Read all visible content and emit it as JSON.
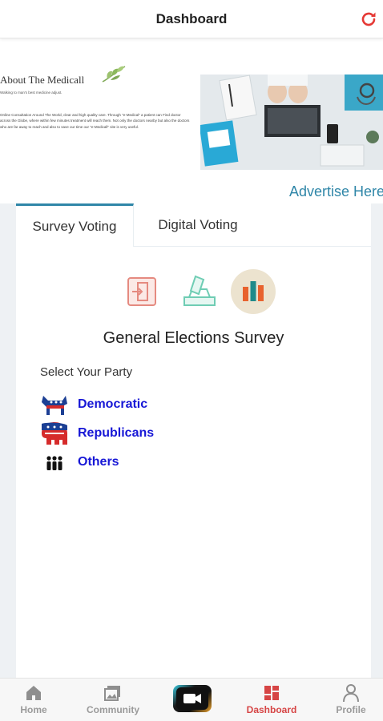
{
  "header": {
    "title": "Dashboard",
    "refresh_icon": "refresh-icon",
    "accent_color": "#e53935"
  },
  "banner": {
    "title": "About The Medicall",
    "subtitle": "Walking to man's best medicine adjust.",
    "body": "Online Consultation Around The World, clear and high quality care. Through \"e-Medical\" a patient can Find doctor across the Globe, where within few minutes treatment will reach them. Not only the doctors nearby but also the doctors who are far away to reach and also to save our time our \"e-Medicall\" site is very useful.",
    "advertise_link": "Advertise Here"
  },
  "tabs": [
    {
      "label": "Survey Voting",
      "active": true
    },
    {
      "label": "Digital Voting",
      "active": false
    }
  ],
  "survey": {
    "icons": [
      "vote-entry-icon",
      "ballot-box-icon",
      "bar-chart-icon"
    ],
    "title": "General Elections Survey",
    "select_label": "Select Your Party",
    "parties": [
      {
        "label": "Democratic",
        "icon": "donkey-icon"
      },
      {
        "label": "Republicans",
        "icon": "elephant-icon"
      },
      {
        "label": "Others",
        "icon": "people-icon"
      }
    ]
  },
  "bottom_nav": {
    "items": [
      {
        "label": "Home",
        "icon": "home-icon"
      },
      {
        "label": "Community",
        "icon": "image-gallery-icon"
      },
      {
        "label": "",
        "icon": "video-camera-icon"
      },
      {
        "label": "Dashboard",
        "icon": "dashboard-icon",
        "active": true
      },
      {
        "label": "Profile",
        "icon": "person-icon"
      }
    ],
    "active_color": "#d64545",
    "inactive_color": "#9a9a9a"
  }
}
